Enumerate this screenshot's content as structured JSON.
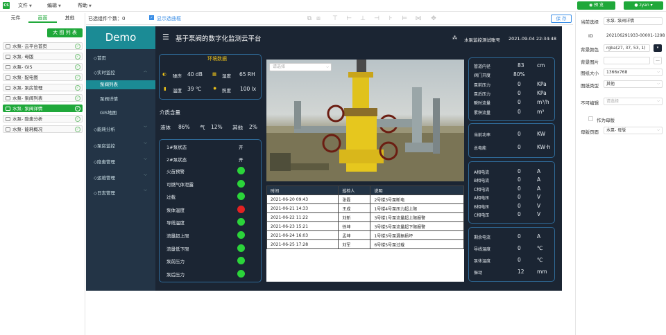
{
  "menubar": {
    "logo": "CS",
    "items": [
      {
        "label": "文件"
      },
      {
        "label": "编辑"
      },
      {
        "label": "帮助"
      }
    ],
    "preview": "预 览",
    "user": "zyan"
  },
  "left": {
    "tabs": [
      "元件",
      "画面",
      "其他"
    ],
    "list_button": "大 图 列 表",
    "pages": [
      "水泵- 云平台首页",
      "水泵- 母版",
      "水泵- GIS",
      "水泵- 配电图",
      "水泵- 泵房管理",
      "水泵- 泵阀列表",
      "水泵- 泵阀详情",
      "水泵- 隐患分析",
      "水泵- 能耗概况"
    ],
    "selected_index": 6
  },
  "toolbar": {
    "selected_count_label": "已选组件个数：0",
    "show_checkbox_label": "显示选曲框",
    "save_label": "保 存"
  },
  "nav": {
    "brand": "Demo",
    "items": [
      {
        "label": "◇首页"
      },
      {
        "label": "◇实时监控"
      },
      {
        "label": "◇能耗分析"
      },
      {
        "label": "◇泵房监控"
      },
      {
        "label": "◇隐患管理"
      },
      {
        "label": "◇运维管理"
      },
      {
        "label": "◇日志管理"
      }
    ],
    "sub": [
      {
        "label": "泵阀列表"
      },
      {
        "label": "泵阀详情"
      },
      {
        "label": "GIS地图"
      }
    ]
  },
  "header": {
    "title": "基于泵阀的数字化监测云平台",
    "account": "水泵监控测试账号",
    "datetime": "2021-09-04 22:34:48"
  },
  "env": {
    "title": "环境数据",
    "noise_label": "噪声",
    "noise": "40 dB",
    "humidity_label": "湿度",
    "humidity": "65 RH",
    "temp_label": "温度",
    "temp": "39 ℃",
    "lux_label": "照度",
    "lux": "100 lx"
  },
  "medium": {
    "title": "介质含量",
    "liquid_label": "液体",
    "liquid": "86%",
    "gas_label": "气",
    "gas": "12%",
    "other_label": "其他",
    "other": "2%"
  },
  "status": {
    "rows": [
      {
        "label": "1#泵状态",
        "value": "开"
      },
      {
        "label": "2#泵状态",
        "value": "开"
      }
    ],
    "alarms": [
      {
        "label": "火苗预警",
        "state": "ok"
      },
      {
        "label": "可燃气体泄露",
        "state": "ok"
      },
      {
        "label": "过载",
        "state": "ok"
      },
      {
        "label": "泵体温度",
        "state": "alarm"
      },
      {
        "label": "导线温度",
        "state": "ok"
      },
      {
        "label": "流量超上限",
        "state": "ok"
      },
      {
        "label": "流量低下限",
        "state": "ok"
      },
      {
        "label": "泵前压力",
        "state": "ok"
      },
      {
        "label": "泵后压力",
        "state": "ok"
      }
    ],
    "colors": {
      "ok": "#2bd43a",
      "alarm": "#e32222"
    }
  },
  "photo": {
    "select_placeholder": "请选择"
  },
  "log": {
    "headers": [
      "时间",
      "巡检人",
      "说明"
    ],
    "rows": [
      [
        "2021-06-20 09:43",
        "张磊",
        "2号楼3号泵断电"
      ],
      [
        "2021-06-21 14:33",
        "王成",
        "1号楼4号泵压力超上限"
      ],
      [
        "2021-06-22 11:22",
        "刘新",
        "3号楼1号泵流量超上限报警"
      ],
      [
        "2021-06-23 15:21",
        "徐坤",
        "3号楼5号泵流量超下限报警"
      ],
      [
        "2021-06-24 16:03",
        "孟坤",
        "1号楼3号泵漏振损坏"
      ],
      [
        "2021-06-25 17:28",
        "刘军",
        "6号楼5号泵过载"
      ]
    ]
  },
  "metrics1": [
    {
      "label": "管道内径",
      "value": "83",
      "unit": "cm"
    },
    {
      "label": "阀门开度",
      "value": "80%",
      "unit": ""
    },
    {
      "label": "泵前压力",
      "value": "0",
      "unit": "KPa"
    },
    {
      "label": "泵后压力",
      "value": "0",
      "unit": "KPa"
    },
    {
      "label": "瞬时流量",
      "value": "0",
      "unit": "m³/h"
    },
    {
      "label": "累积流量",
      "value": "0",
      "unit": "m³"
    }
  ],
  "metrics2": [
    {
      "label": "当前功率",
      "value": "0",
      "unit": "KW"
    },
    {
      "label": "总电能",
      "value": "0",
      "unit": "KW·h"
    }
  ],
  "metrics3": [
    {
      "label": "A相电流",
      "value": "0",
      "unit": "A"
    },
    {
      "label": "B相电流",
      "value": "0",
      "unit": "A"
    },
    {
      "label": "C相电流",
      "value": "0",
      "unit": "A"
    },
    {
      "label": "A相电压",
      "value": "0",
      "unit": "V"
    },
    {
      "label": "B相电压",
      "value": "0",
      "unit": "V"
    },
    {
      "label": "C相电压",
      "value": "0",
      "unit": "V"
    }
  ],
  "metrics4": [
    {
      "label": "剩余电流",
      "value": "0",
      "unit": "A"
    },
    {
      "label": "导线温度",
      "value": "0",
      "unit": "℃"
    },
    {
      "label": "泵体温度",
      "value": "0",
      "unit": "℃"
    },
    {
      "label": "振动",
      "value": "12",
      "unit": "mm"
    }
  ],
  "props": {
    "current_label": "当前选择",
    "current": "水泵- 泵阀详情",
    "id_label": "ID",
    "id": "20210629193​3-00001-1298",
    "bgcolor_label": "背景颜色",
    "bgcolor": "rgba(27, 37, 53, 1)",
    "bgimg_label": "背景图片",
    "size_label": "图纸大小",
    "size": "1366x768",
    "type_label": "图纸类型",
    "type": "其他",
    "noedit_label": "不可编辑",
    "noedit_placeholder": "请选择",
    "asmaster_label": "作为母版",
    "master_label": "母版页面",
    "master": "水泵- 母版"
  }
}
